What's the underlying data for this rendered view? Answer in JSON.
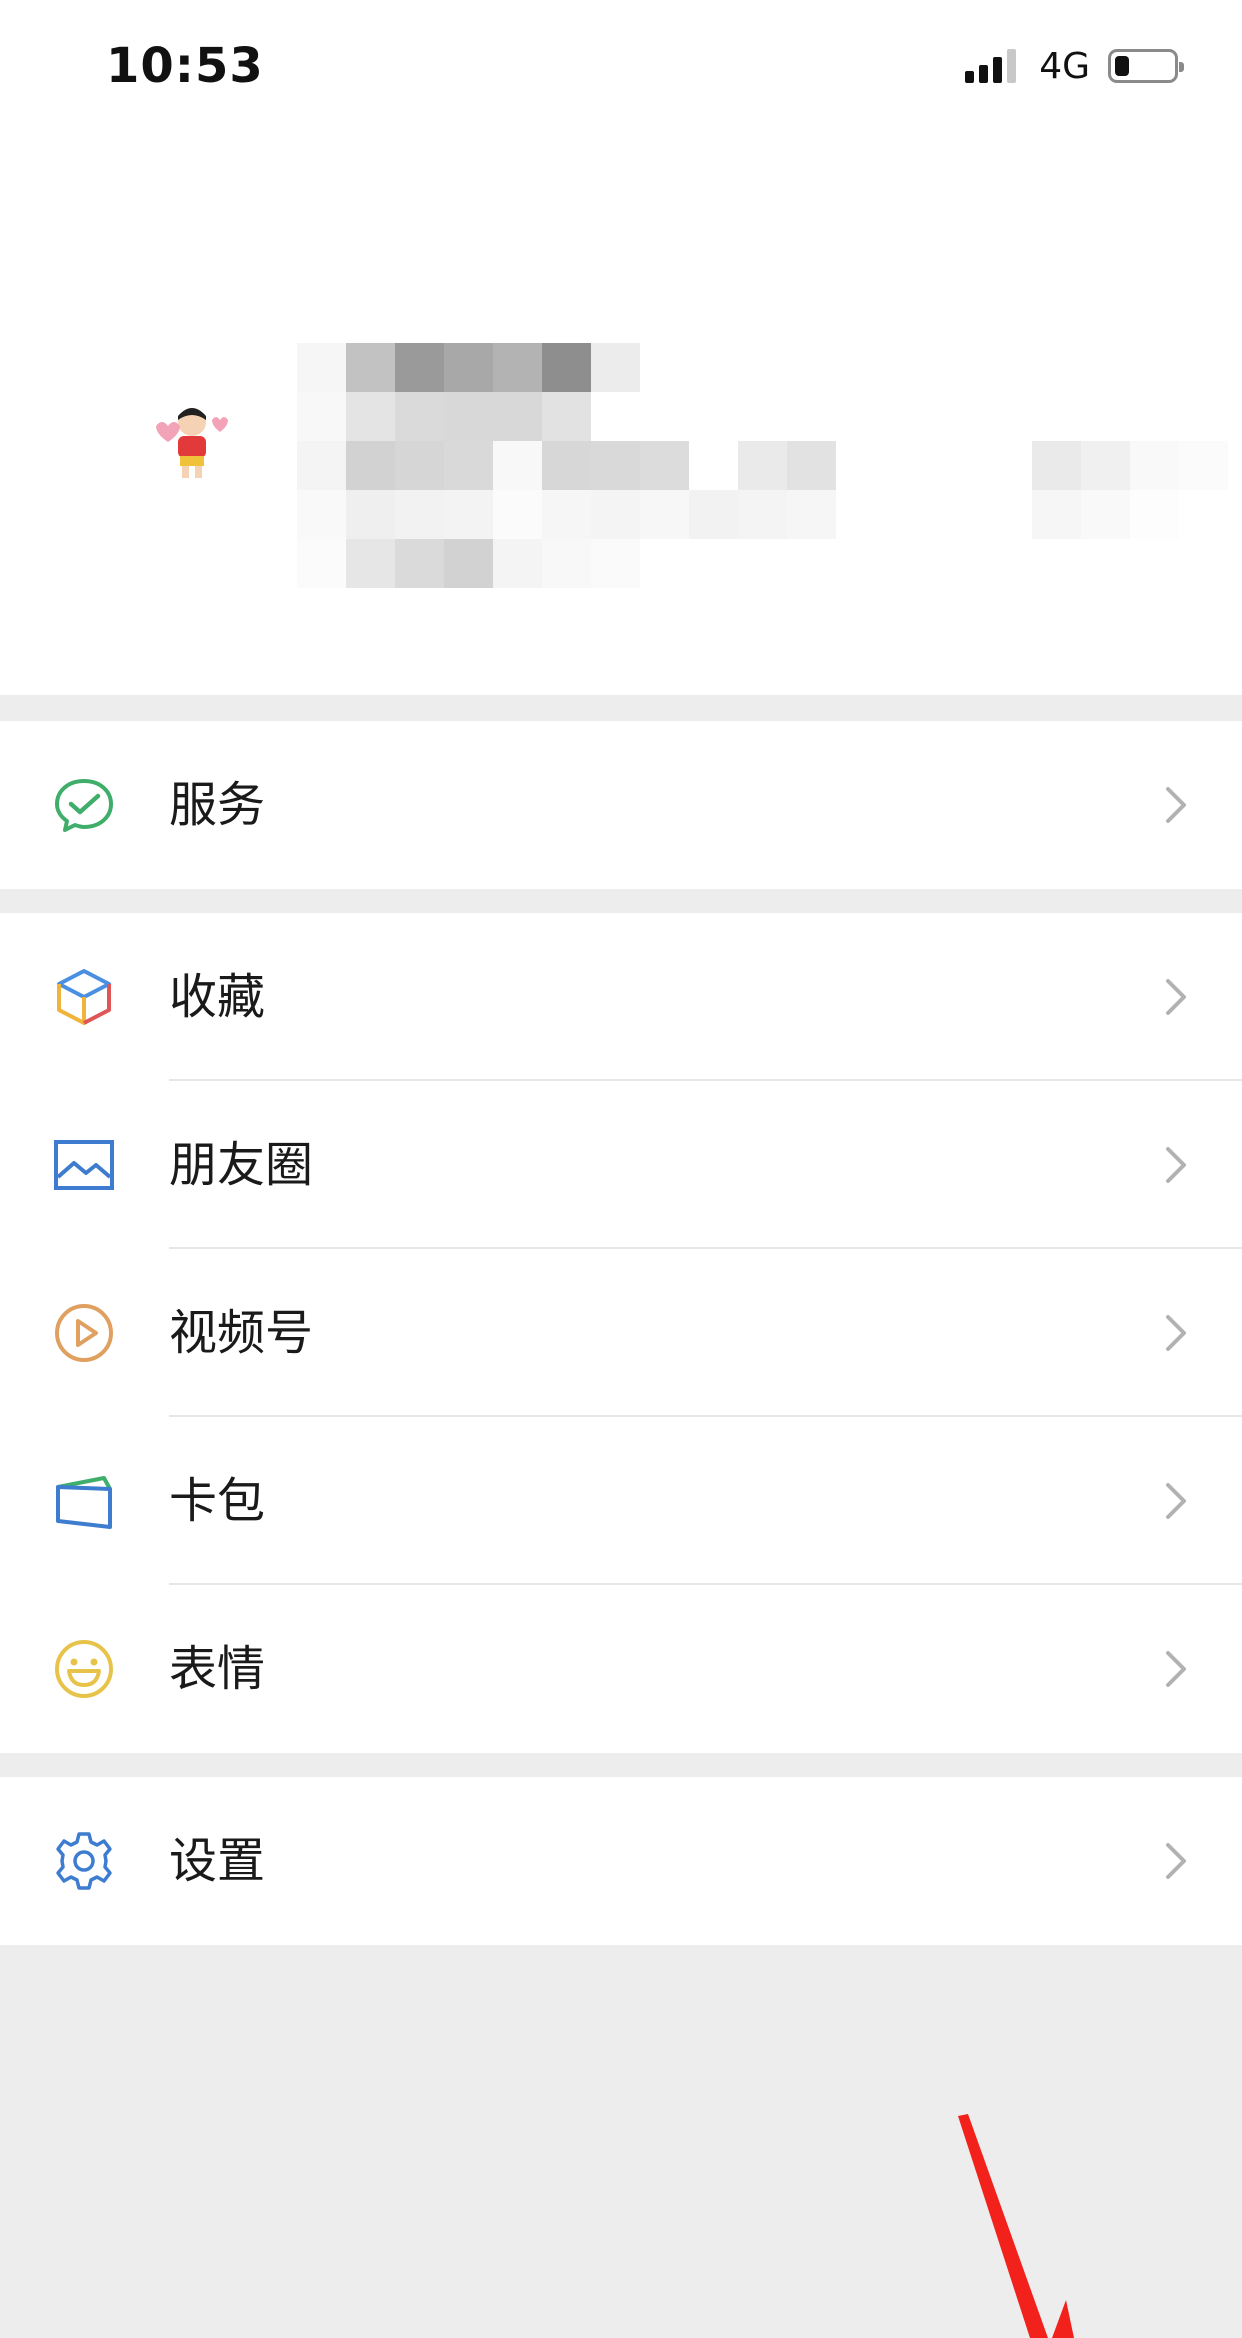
{
  "status_bar": {
    "time": "10:53",
    "network": "4G",
    "signal_bars": 4,
    "signal_bars_filled": 3,
    "battery_level": 0.25
  },
  "profile": {
    "avatar_icon": "avatar-cartoon-icon",
    "info_pixelated": true
  },
  "menu": {
    "service": {
      "label": "服务",
      "icon": "wechat-pay-check-icon",
      "color": "#3fae6a"
    },
    "favorites": {
      "label": "收藏",
      "icon": "cube-icon",
      "color": "#4a8fe0"
    },
    "moments": {
      "label": "朋友圈",
      "icon": "picture-icon",
      "color": "#3d7ccf"
    },
    "channels": {
      "label": "视频号",
      "icon": "play-circle-icon",
      "color": "#e0a060"
    },
    "cards": {
      "label": "卡包",
      "icon": "card-wallet-icon",
      "color": "#3d7ccf"
    },
    "stickers": {
      "label": "表情",
      "icon": "smile-icon",
      "color": "#e8c34a"
    },
    "settings": {
      "label": "设置",
      "icon": "gear-icon",
      "color": "#3d7ccf"
    }
  },
  "colors": {
    "background": "#ededed",
    "panel": "#ffffff",
    "arrow_annotation": "#f2211c"
  }
}
